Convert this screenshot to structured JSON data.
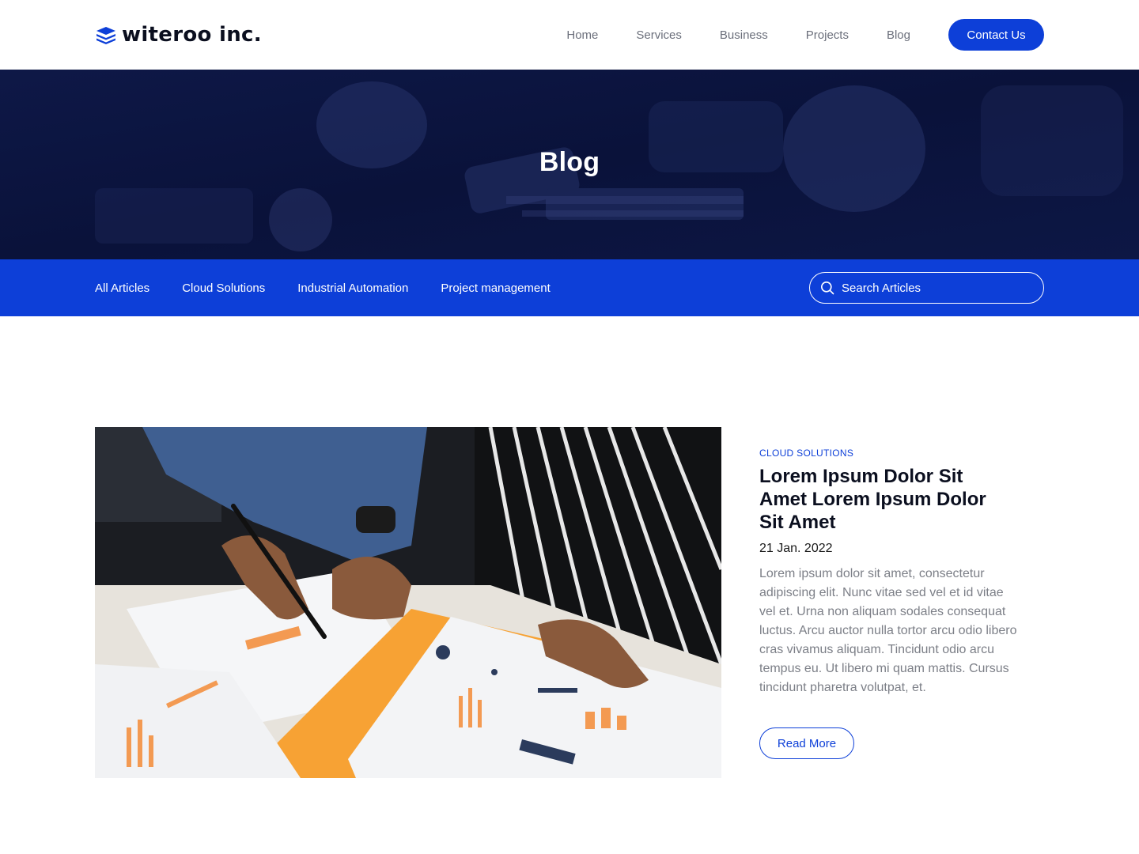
{
  "brand": {
    "name": "witeroo inc.",
    "accent": "#0d3fd8",
    "hero_bg": "#0c1540"
  },
  "nav": {
    "links": [
      "Home",
      "Services",
      "Business",
      "Projects",
      "Blog"
    ],
    "cta": "Contact Us"
  },
  "hero": {
    "title": "Blog"
  },
  "categories": [
    "All Articles",
    "Cloud Solutions",
    "Industrial Automation",
    "Project management"
  ],
  "search": {
    "placeholder": "Search Articles",
    "icon": "search-icon"
  },
  "article": {
    "category": "CLOUD SOLUTIONS",
    "title": "Lorem Ipsum Dolor Sit Amet Lorem Ipsum Dolor Sit Amet",
    "date": "21 Jan. 2022",
    "excerpt": "Lorem ipsum dolor sit amet, consectetur adipiscing elit. Nunc vitae sed vel et id vitae vel et. Urna non aliquam sodales consequat luctus. Arcu auctor nulla tortor arcu odio libero cras vivamus aliquam. Tincidunt odio arcu tempus eu. Ut libero mi quam mattis. Cursus tincidunt pharetra volutpat, et.",
    "read_more": "Read More"
  }
}
